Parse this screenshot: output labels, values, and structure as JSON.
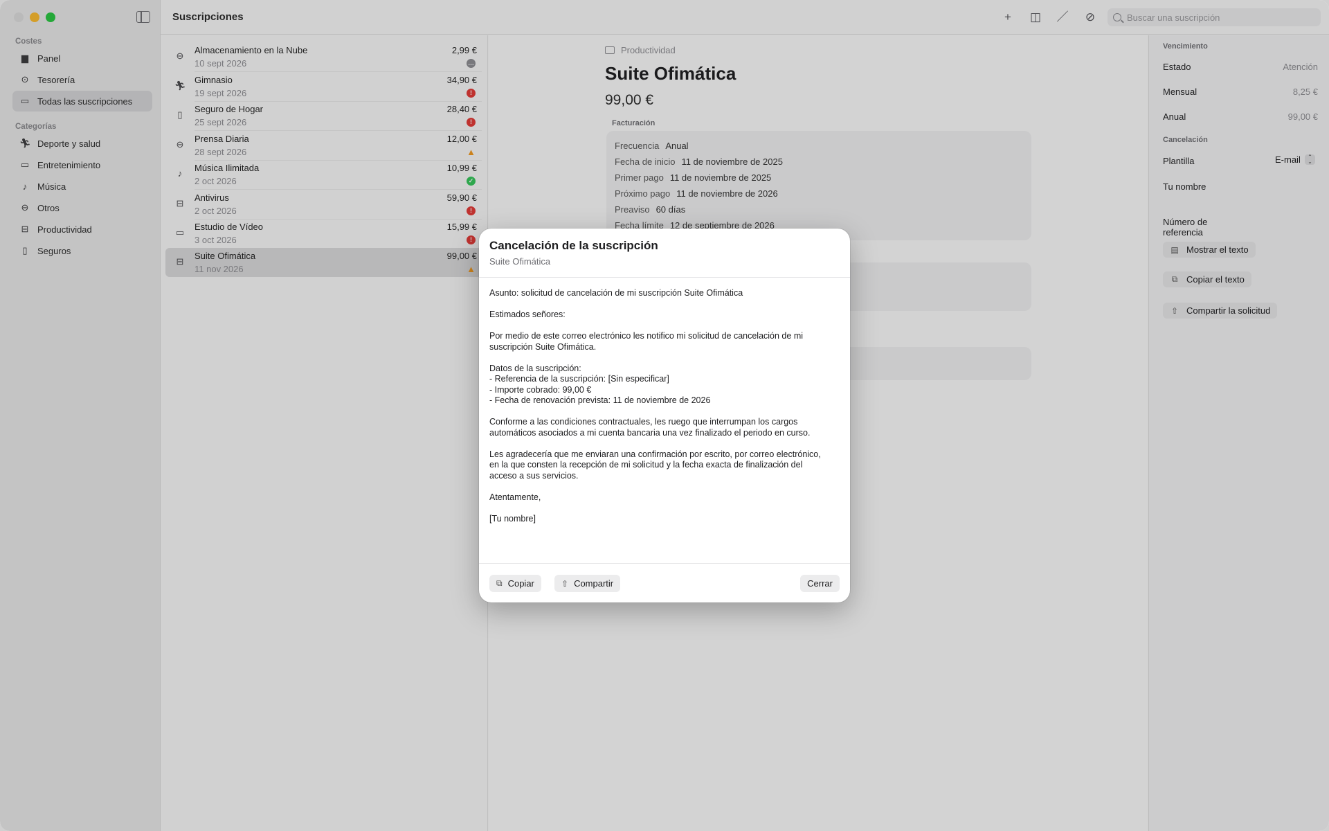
{
  "app": {
    "title": "Suscripciones"
  },
  "search": {
    "placeholder": "Buscar una suscripción"
  },
  "sidebar": {
    "section_costs": "Costes",
    "section_categories": "Categorías",
    "items": [
      {
        "label": "Panel",
        "icon": "chart-bars-icon"
      },
      {
        "label": "Tesorería",
        "icon": "euro-circle-icon"
      },
      {
        "label": "Todas las suscripciones",
        "icon": "card-icon"
      }
    ],
    "categories": [
      {
        "label": "Deporte y salud",
        "icon": "runner-icon"
      },
      {
        "label": "Entretenimiento",
        "icon": "tv-icon"
      },
      {
        "label": "Música",
        "icon": "music-note-icon"
      },
      {
        "label": "Otros",
        "icon": "minus-circle-icon"
      },
      {
        "label": "Productividad",
        "icon": "briefcase-icon"
      },
      {
        "label": "Seguros",
        "icon": "bookmark-icon"
      }
    ]
  },
  "list": [
    {
      "name": "Almacenamiento en la Nube",
      "date": "10 sept 2026",
      "price": "2,99 €",
      "status": "gray",
      "status_glyph": "…"
    },
    {
      "name": "Gimnasio",
      "date": "19 sept 2026",
      "price": "34,90 €",
      "status": "red",
      "status_glyph": "!"
    },
    {
      "name": "Seguro de Hogar",
      "date": "25 sept 2026",
      "price": "28,40 €",
      "status": "red",
      "status_glyph": "!"
    },
    {
      "name": "Prensa Diaria",
      "date": "28 sept 2026",
      "price": "12,00 €",
      "status": "warn",
      "status_glyph": "▲"
    },
    {
      "name": "Música Ilimitada",
      "date": "2 oct 2026",
      "price": "10,99 €",
      "status": "green",
      "status_glyph": "✓"
    },
    {
      "name": "Antivirus",
      "date": "2 oct 2026",
      "price": "59,90 €",
      "status": "red",
      "status_glyph": "!"
    },
    {
      "name": "Estudio de Vídeo",
      "date": "3 oct 2026",
      "price": "15,99 €",
      "status": "red",
      "status_glyph": "!"
    },
    {
      "name": "Suite Ofimática",
      "date": "11 nov 2026",
      "price": "99,00 €",
      "status": "warn",
      "status_glyph": "▲"
    }
  ],
  "detail": {
    "category": "Productividad",
    "title": "Suite Ofimática",
    "price": "99,00 €",
    "billing_section": "Facturación",
    "billing": [
      {
        "k": "Frecuencia",
        "v": "Anual"
      },
      {
        "k": "Fecha de inicio",
        "v": "11 de noviembre de 2025"
      },
      {
        "k": "Primer pago",
        "v": "11 de noviembre de 2025"
      },
      {
        "k": "Próximo pago",
        "v": "11 de noviembre de 2026"
      },
      {
        "k": "Preaviso",
        "v": "60 días"
      },
      {
        "k": "Fecha límite",
        "v": "12 de septiembre de 2026"
      }
    ]
  },
  "inspector": {
    "due_section": "Vencimiento",
    "estado_label": "Estado",
    "estado_value": "Atención",
    "mensual_label": "Mensual",
    "mensual_value": "8,25 €",
    "anual_label": "Anual",
    "anual_value": "99,00 €",
    "cancel_section": "Cancelación",
    "plantilla_label": "Plantilla",
    "plantilla_value": "E-mail",
    "nombre_label": "Tu nombre",
    "referencia_label": "Número de\nreferencia",
    "show_text": "Mostrar el texto",
    "copy_text": "Copiar el texto",
    "share_request": "Compartir la solicitud"
  },
  "modal": {
    "title": "Cancelación de la suscripción",
    "subtitle": "Suite Ofimática",
    "body": "Asunto: solicitud de cancelación de mi suscripción Suite Ofimática\n\nEstimados señores:\n\nPor medio de este correo electrónico les notifico mi solicitud de cancelación de mi\nsuscripción Suite Ofimática.\n\nDatos de la suscripción:\n- Referencia de la suscripción: [Sin especificar]\n- Importe cobrado: 99,00 €\n- Fecha de renovación prevista: 11 de noviembre de 2026\n\nConforme a las condiciones contractuales, les ruego que interrumpan los cargos\nautomáticos asociados a mi cuenta bancaria una vez finalizado el periodo en curso.\n\nLes agradecería que me enviaran una confirmación por escrito, por correo electrónico,\nen la que consten la recepción de mi solicitud y la fecha exacta de finalización del\nacceso a sus servicios.\n\nAtentamente,\n\n[Tu nombre]",
    "copy_label": "Copiar",
    "share_label": "Compartir",
    "close_label": "Cerrar"
  }
}
